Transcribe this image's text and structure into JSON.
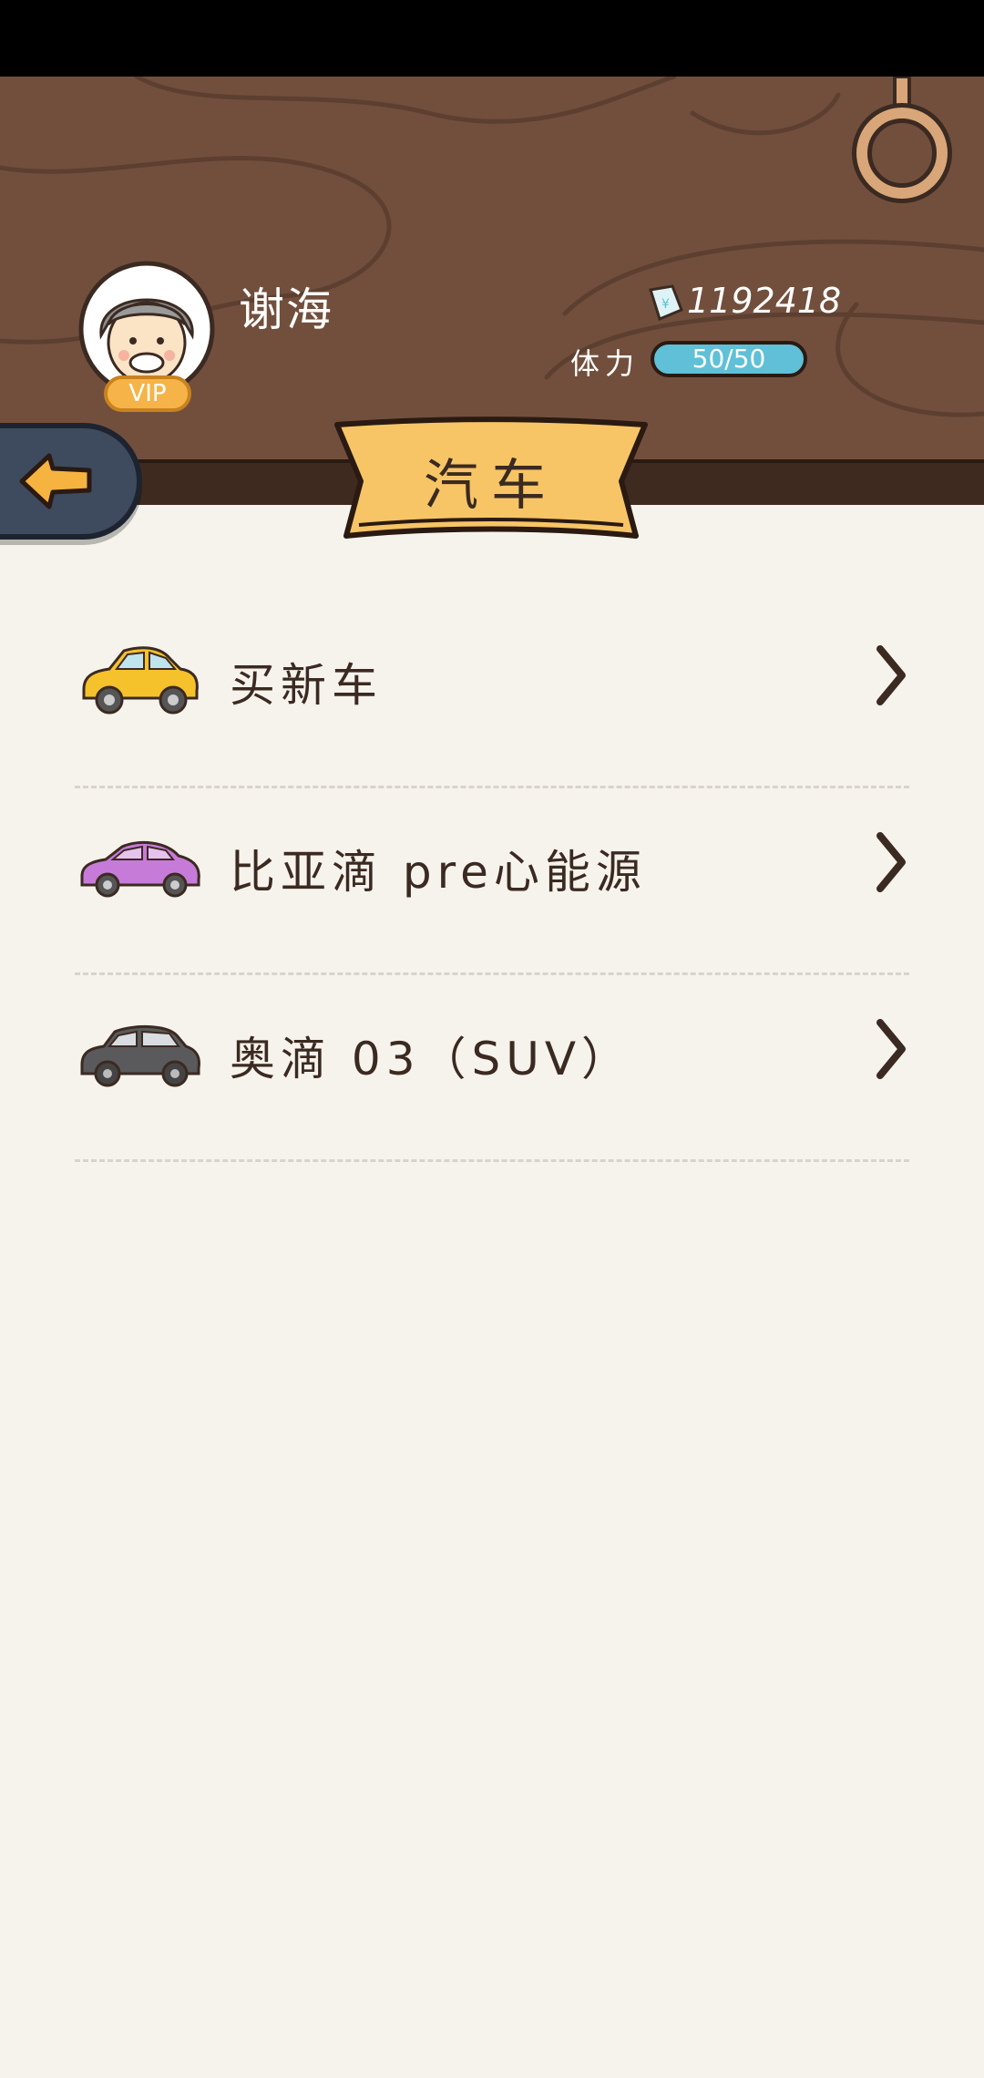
{
  "player": {
    "name": "谢海",
    "vip_label": "VIP",
    "money": "1192418",
    "stamina_label": "体力",
    "stamina_value": "50/50"
  },
  "page": {
    "title": "汽车"
  },
  "menu": {
    "items": [
      {
        "label": "买新车",
        "icon": "yellow-car-icon"
      },
      {
        "label": "比亚滴 pre心能源",
        "icon": "purple-car-icon"
      },
      {
        "label": "奥滴 03（SUV）",
        "icon": "gray-suv-icon"
      }
    ]
  },
  "colors": {
    "header_brown": "#724f3d",
    "background": "#f6f3ec",
    "banner_yellow": "#f7c566",
    "stamina_blue": "#5fc0d7",
    "back_button": "#3e4b5e"
  }
}
